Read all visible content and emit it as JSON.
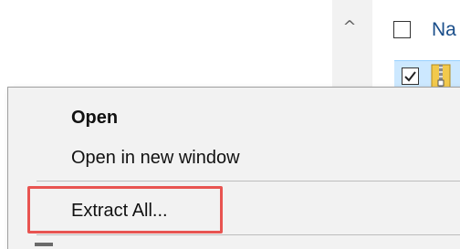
{
  "file_list": {
    "name_column_label": "Na",
    "scroll_up_glyph": "^",
    "header_checkbox_checked": false,
    "selected_row_checked": true,
    "selected_row_icon": "zip-folder-icon"
  },
  "context_menu": {
    "items": [
      {
        "label": "Open",
        "bold": true
      },
      {
        "label": "Open in new window",
        "bold": false
      },
      {
        "label": "Extract All...",
        "bold": false,
        "highlighted": true
      }
    ]
  },
  "colors": {
    "highlight_border": "#e85451",
    "menu_background": "#f2f2f2",
    "column_text": "#1a4e8a",
    "selection_background": "#cce8ff"
  }
}
